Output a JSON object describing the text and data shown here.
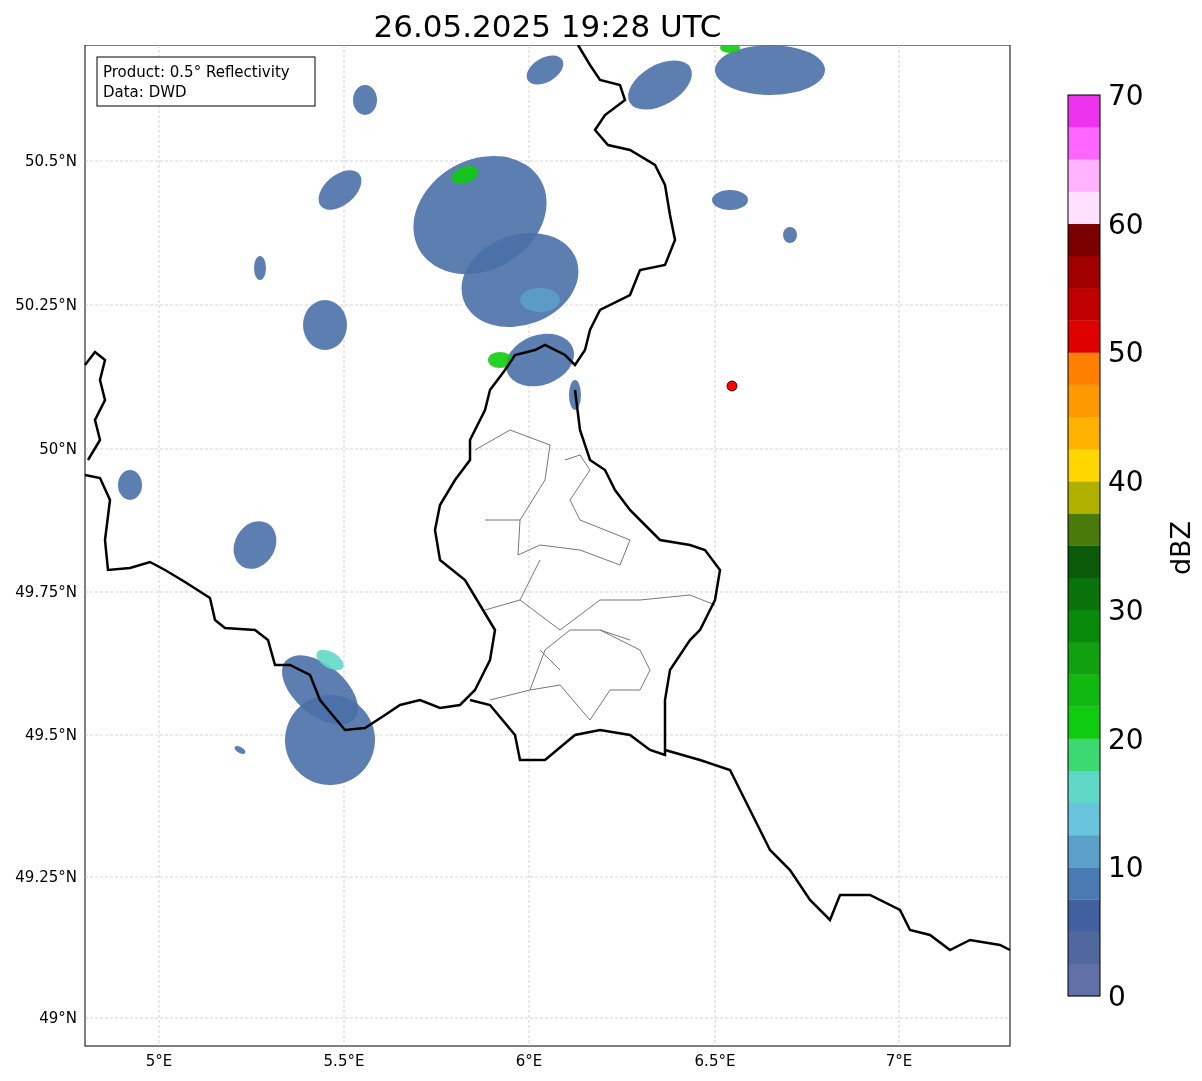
{
  "title": "26.05.2025 19:28 UTC",
  "legend": [
    "Product: 0.5° Reflectivity",
    "Data: DWD"
  ],
  "yticks": [
    "50.5°N",
    "50.25°N",
    "50°N",
    "49.75°N",
    "49.5°N",
    "49.25°N",
    "49°N"
  ],
  "xticks": [
    "5°E",
    "5.5°E",
    "6°E",
    "6.5°E",
    "7°E"
  ],
  "colorbar": {
    "label": "dBZ",
    "ticks": [
      "70",
      "60",
      "50",
      "40",
      "30",
      "20",
      "10",
      "0"
    ],
    "bands": [
      {
        "color": "#6270a8"
      },
      {
        "color": "#50689e"
      },
      {
        "color": "#4060a0"
      },
      {
        "color": "#4a7ab2"
      },
      {
        "color": "#5aa0c8"
      },
      {
        "color": "#68c4dc"
      },
      {
        "color": "#60d8c8"
      },
      {
        "color": "#3cd870"
      },
      {
        "color": "#10cc10"
      },
      {
        "color": "#10b810"
      },
      {
        "color": "#10a010"
      },
      {
        "color": "#0a8a0a"
      },
      {
        "color": "#0a720a"
      },
      {
        "color": "#0a5a0a"
      },
      {
        "color": "#4a7a0a"
      },
      {
        "color": "#b0b000"
      },
      {
        "color": "#ffd700"
      },
      {
        "color": "#ffb300"
      },
      {
        "color": "#ff9900"
      },
      {
        "color": "#ff7f00"
      },
      {
        "color": "#e00000"
      },
      {
        "color": "#c00000"
      },
      {
        "color": "#a00000"
      },
      {
        "color": "#7a0000"
      },
      {
        "color": "#ffe0ff"
      },
      {
        "color": "#ffb3ff"
      },
      {
        "color": "#ff66ff"
      },
      {
        "color": "#ee33ee"
      }
    ]
  }
}
